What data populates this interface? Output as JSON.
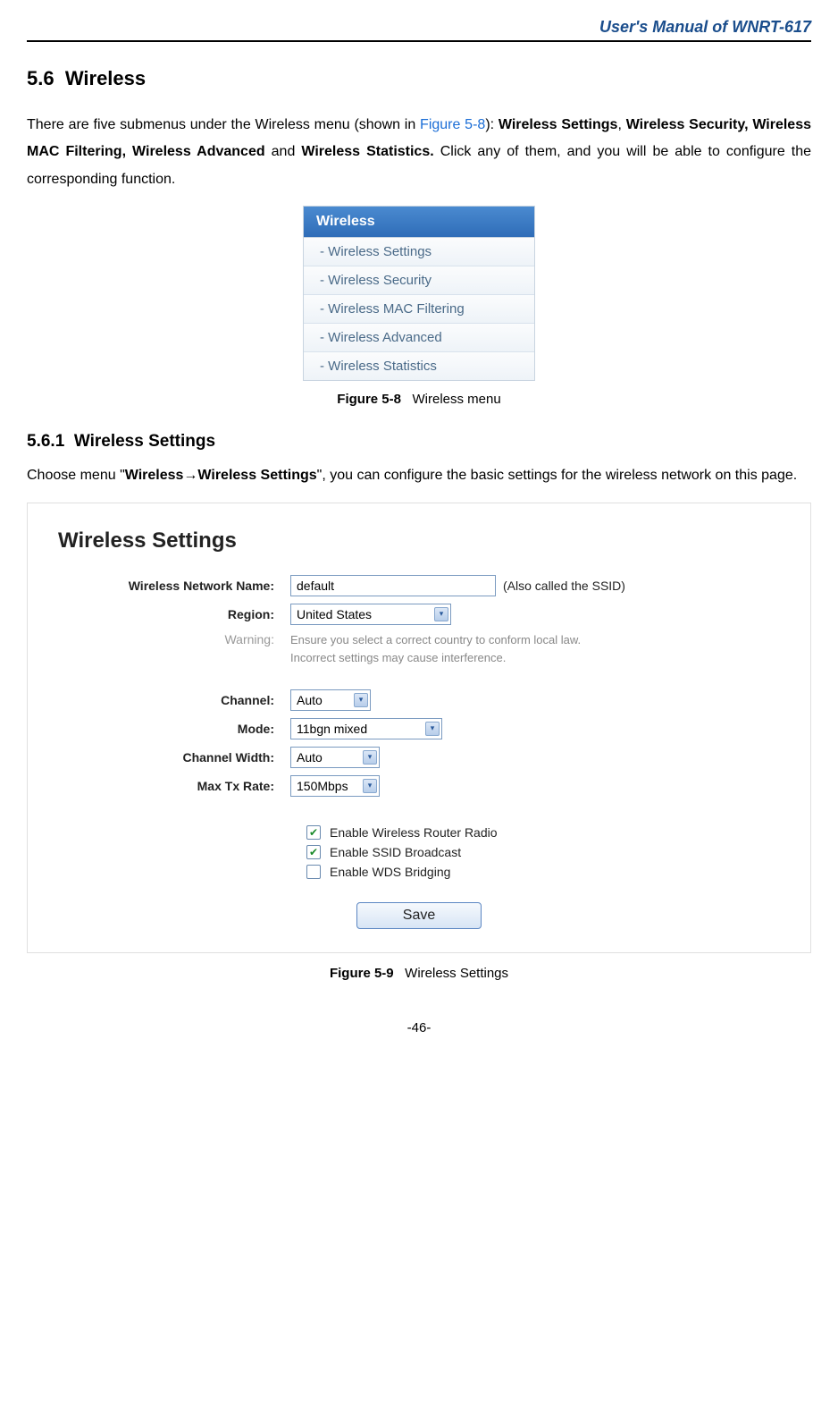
{
  "header": {
    "title": "User's Manual of WNRT-617"
  },
  "section": {
    "num": "5.6",
    "title": "Wireless",
    "intro_1": "There are five submenus under the Wireless menu (shown in ",
    "intro_ref": "Figure 5-8",
    "intro_2": "): ",
    "intro_bold1": "Wireless Settings",
    "intro_3": ", ",
    "intro_bold2": "Wireless Security, Wireless MAC Filtering, Wireless Advanced",
    "intro_4": " and ",
    "intro_bold3": "Wireless Statistics.",
    "intro_5": " Click any of them, and you will be able to configure the corresponding function."
  },
  "menu": {
    "header": "Wireless",
    "items": [
      "- Wireless Settings",
      "- Wireless Security",
      "- Wireless MAC Filtering",
      "- Wireless Advanced",
      "- Wireless Statistics"
    ]
  },
  "fig1": {
    "label": "Figure 5-8",
    "caption": "Wireless menu"
  },
  "sub": {
    "num": "5.6.1",
    "title": "Wireless Settings",
    "para_1": "Choose menu \"",
    "para_bold": "Wireless→Wireless Settings",
    "para_2": "\", you can configure the basic settings for the wireless network on this page."
  },
  "panel": {
    "title": "Wireless Settings",
    "rows": {
      "name_label": "Wireless Network Name:",
      "name_value": "default",
      "name_after": "(Also called the SSID)",
      "region_label": "Region:",
      "region_value": "United States",
      "warning_label": "Warning:",
      "warning_l1": "Ensure you select a correct country to conform local law.",
      "warning_l2": "Incorrect settings may cause interference.",
      "channel_label": "Channel:",
      "channel_value": "Auto",
      "mode_label": "Mode:",
      "mode_value": "11bgn mixed",
      "cw_label": "Channel Width:",
      "cw_value": "Auto",
      "tx_label": "Max Tx Rate:",
      "tx_value": "150Mbps"
    },
    "checks": {
      "c1": "Enable Wireless Router Radio",
      "c2": "Enable SSID Broadcast",
      "c3": "Enable WDS Bridging"
    },
    "save": "Save"
  },
  "fig2": {
    "label": "Figure 5-9",
    "caption": "Wireless Settings"
  },
  "page": "-46-"
}
